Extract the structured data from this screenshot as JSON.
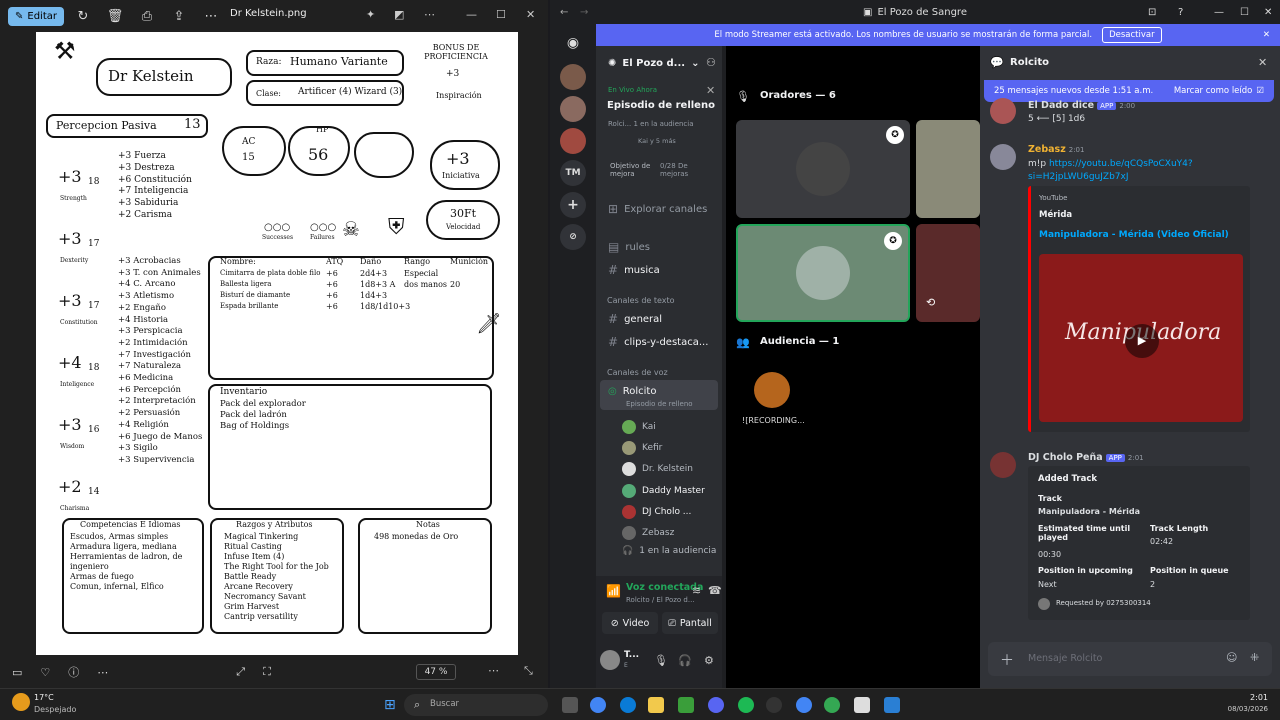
{
  "photos": {
    "edit_label": "Editar",
    "filename": "Dr Kelstein.png",
    "zoom": "47 %"
  },
  "sheet": {
    "name": "Dr Kelstein",
    "race_label": "Raza:",
    "race": "Humano Variante",
    "class_label": "Clase:",
    "class": "Artificer (4) Wizard (3)",
    "prof_title": "BONUS DE PROFICIENCIA",
    "prof": "+3",
    "inspiration": "Inspiración",
    "passive": "Percepcion Pasiva",
    "passive_val": "13",
    "ac_label": "AC",
    "ac": "15",
    "hp_label": "HP",
    "hp": "56",
    "initiative": "+3",
    "initiative_label": "Iniciativa",
    "speed": "30Ft",
    "speed_label": "Velocidad",
    "successes": "Successes",
    "failures": "Failures",
    "abilities": [
      {
        "mod": "+3",
        "score": "18",
        "label": "Strength"
      },
      {
        "mod": "+3",
        "score": "17",
        "label": "Dexterity"
      },
      {
        "mod": "+3",
        "score": "17",
        "label": "Constitution"
      },
      {
        "mod": "+4",
        "score": "18",
        "label": "Inteligence"
      },
      {
        "mod": "+3",
        "score": "16",
        "label": "Wisdom"
      },
      {
        "mod": "+2",
        "score": "14",
        "label": "Charisma"
      }
    ],
    "saves": [
      "+3 Fuerza",
      "+3 Destreza",
      "+6 Constitución",
      "+7 Inteligencia",
      "+3 Sabiduria",
      "+2 Carisma"
    ],
    "skills": [
      "+3 Acrobacias",
      "+3 T. con Animales",
      "+4 C. Arcano",
      "+3 Atletismo",
      "+2 Engaño",
      "+4 Historia",
      "+3 Perspicacia",
      "+2 Intimidación",
      "+7 Investigación",
      "+7 Naturaleza",
      "+6 Medicina",
      "+6 Percepción",
      "+2 Interpretación",
      "+2 Persuasión",
      "+4 Religión",
      "+6 Juego de Manos",
      "+3 Sigilo",
      "+3 Supervivencia"
    ],
    "attack_headers": [
      "Nombre:",
      "ATQ",
      "Daño",
      "Rango",
      "Munición"
    ],
    "attacks": [
      [
        "Cimitarra de plata doble filo",
        "+6",
        "2d4+3",
        "Especial",
        ""
      ],
      [
        "Ballesta ligera",
        "+6",
        "1d8+3 A",
        "dos manos",
        "20"
      ],
      [
        "Bisturí de diamante",
        "+6",
        "1d4+3",
        "",
        ""
      ],
      [
        "Espada brillante",
        "+6",
        "1d8/1d10+3",
        "",
        ""
      ]
    ],
    "inventory_title": "Inventario",
    "inventory": [
      "Pack del explorador",
      "Pack del ladrón",
      "Bag of Holdings"
    ],
    "comp_title": "Competencias E Idiomas",
    "comp": [
      "Escudos, Armas simples",
      "Armadura ligera, mediana",
      "Herramientas de ladron, de",
      "ingeniero",
      "Armas de fuego",
      "Comun, infernal, Elfico"
    ],
    "traits_title": "Razgos y Atributos",
    "traits": [
      "Magical Tinkering",
      "Ritual Casting",
      "Infuse Item (4)",
      "The Right Tool for the Job",
      "Battle Ready",
      "Arcane Recovery",
      "Necromancy Savant",
      "Grim Harvest",
      "Cantrip versatility"
    ],
    "notes_title": "Notas",
    "notes": [
      "498 monedas de Oro"
    ]
  },
  "discord": {
    "window_title": "El Pozo de Sangre",
    "banner": "El modo Streamer está activado. Los nombres de usuario se mostrarán de forma parcial.",
    "banner_button": "Desactivar",
    "server_name": "El Pozo d...",
    "live_label": "En Vivo Ahora",
    "event_title": "Episodio de relleno",
    "event_meta": "Rolci...  1 en la audiencia",
    "event_people": "Kai y 5 más",
    "goal_label": "Objetivo de mejora",
    "goal_value": "0/28 De mejoras",
    "explore": "Explorar canales",
    "channels_top": [
      "rules",
      "musica"
    ],
    "text_cat": "Canales de texto",
    "text_channels": [
      "general",
      "clips-y-destaca..."
    ],
    "voice_cat": "Canales de voz",
    "voice_channel": "Rolcito",
    "voice_sub": "Episodio de relleno",
    "members": [
      "Kai",
      "Kefir",
      "Dr. Kelstein",
      "Daddy Master",
      "DJ Cholo ...",
      "Zebasz"
    ],
    "audience_count": "1 en la audiencia",
    "voice_connected": "Voz conectada",
    "voice_connected_sub": "Rolcito / El Pozo d...",
    "video_btn": "Video",
    "screen_btn": "Pantall",
    "user_short": "T...",
    "user_sub": "E",
    "server_tm": "TM",
    "speakers": "Oradores — 6",
    "audience": "Audiencia — 1",
    "audience_member": "![RECORDING...",
    "chat_title": "Rolcito",
    "new_msgs": "25 mensajes nuevos desde 1:51 a.m.",
    "mark_read": "Marcar como leído",
    "messages": [
      {
        "user": "El Dado dice",
        "tag": "APP",
        "time": "2:00",
        "text": "5  ⟵ [5] 1d6"
      },
      {
        "user": "Zebasz",
        "tag": "",
        "time": "2:01",
        "text": "m!p",
        "link": "https://youtu.be/qCQsPoCXuY4?si=H2jpLWU6guJZb7xJ"
      },
      {
        "user": "DJ Cholo Peña",
        "tag": "APP",
        "time": "2:01",
        "text": ""
      }
    ],
    "yt_provider": "YouTube",
    "yt_author": "Mérida",
    "yt_title": "Manipuladora - Mérida (Video Oficial)",
    "yt_overlay": "Manipuladora",
    "track": {
      "heading": "Added Track",
      "track_label": "Track",
      "track_value": "Manipuladora - Mérida",
      "eta_label": "Estimated time until played",
      "eta_value": "00:30",
      "length_label": "Track Length",
      "length_value": "02:42",
      "pos_label": "Position in upcoming",
      "pos_value": "Next",
      "queue_label": "Position in queue",
      "queue_value": "2",
      "requested": "Requested by 0275300314"
    },
    "input_placeholder": "Mensaje Rolcito"
  },
  "taskbar": {
    "temp": "17°C",
    "weather": "Despejado",
    "search": "Buscar",
    "time": "2:01",
    "date": "08/03/2026"
  },
  "colors": {
    "accent": "#5865f2",
    "online": "#23a55a",
    "link": "#00a8fc",
    "photo_accent": "#76b9ed"
  }
}
